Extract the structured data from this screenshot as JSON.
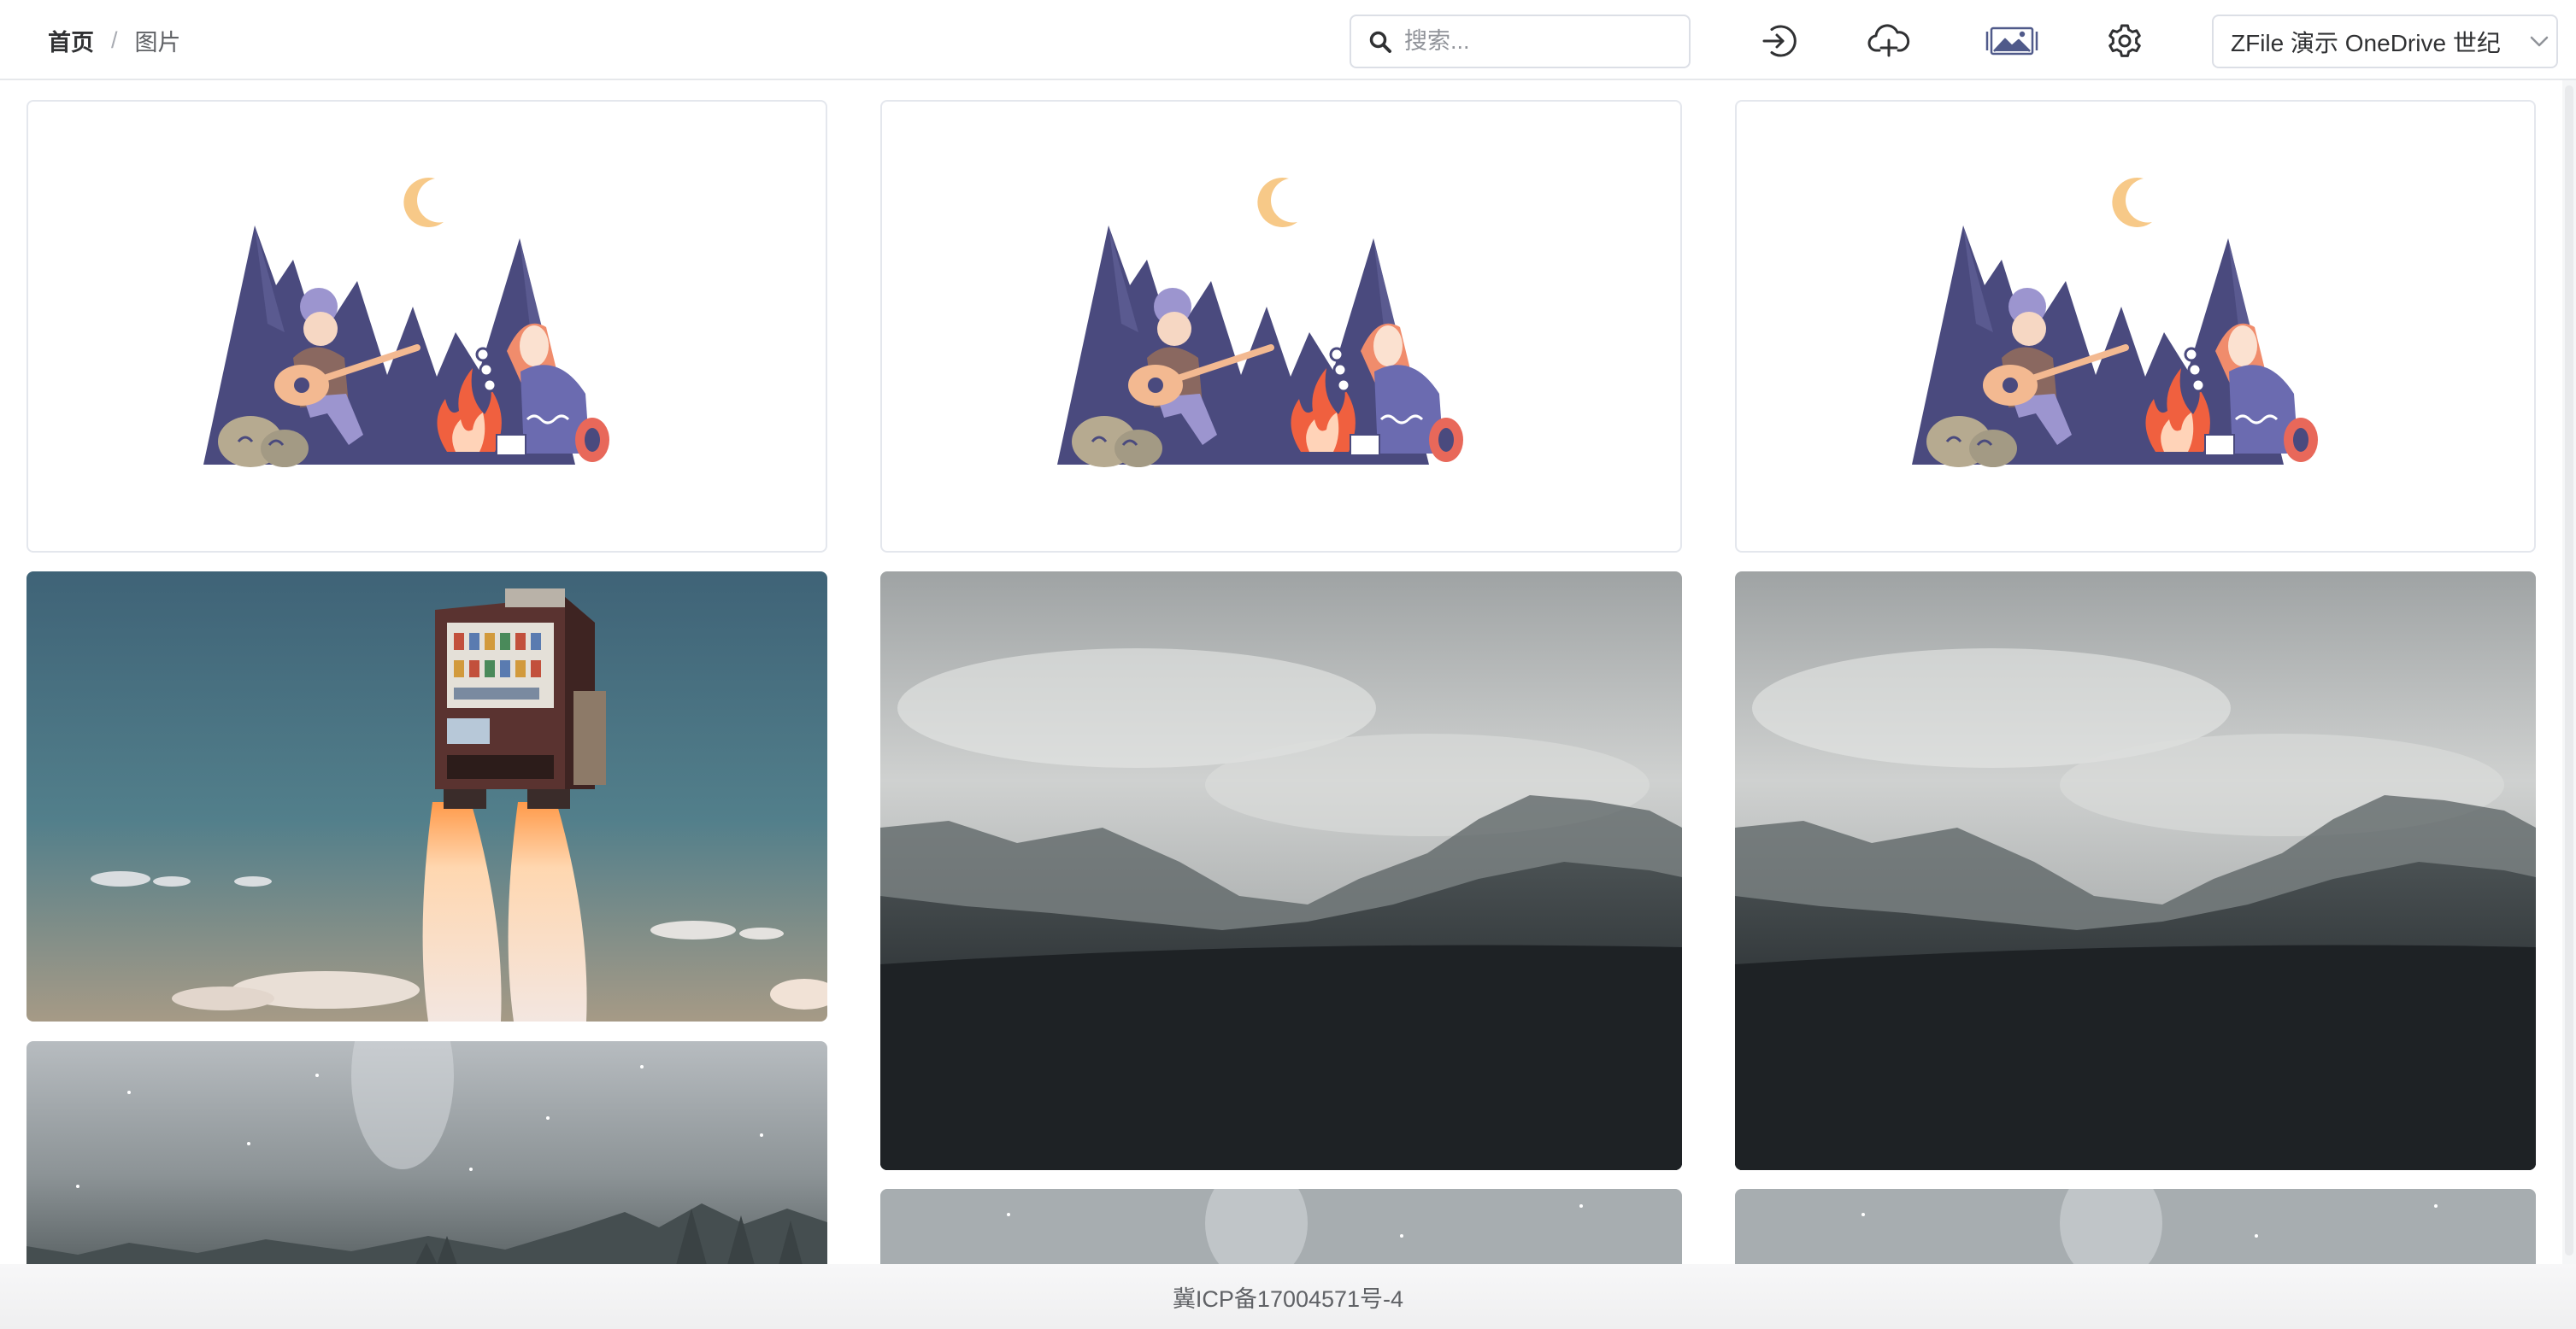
{
  "breadcrumb": {
    "home": "首页",
    "separator": "/",
    "current": "图片"
  },
  "search": {
    "placeholder": "搜索..."
  },
  "header_icons": [
    "login-icon",
    "upload-cloud-icon",
    "gallery-mode-icon",
    "settings-gear-icon"
  ],
  "storage": {
    "selected": "ZFile 演示 OneDrive 世纪"
  },
  "gallery": {
    "images": [
      {
        "kind": "campfire-illustration",
        "column": 1
      },
      {
        "kind": "campfire-illustration",
        "column": 2
      },
      {
        "kind": "campfire-illustration",
        "column": 3
      },
      {
        "kind": "vending-machine-rocket",
        "column": 1
      },
      {
        "kind": "misty-forest",
        "column": 2
      },
      {
        "kind": "misty-forest",
        "column": 3
      },
      {
        "kind": "snowy-forest",
        "column": 1
      },
      {
        "kind": "snowy-forest",
        "column": 2
      },
      {
        "kind": "snowy-forest",
        "column": 3
      }
    ]
  },
  "footer": {
    "icp": "冀ICP备17004571号-4"
  },
  "colors": {
    "accent": "#505a8a",
    "border": "#dcdfe6",
    "text": "#303133"
  }
}
